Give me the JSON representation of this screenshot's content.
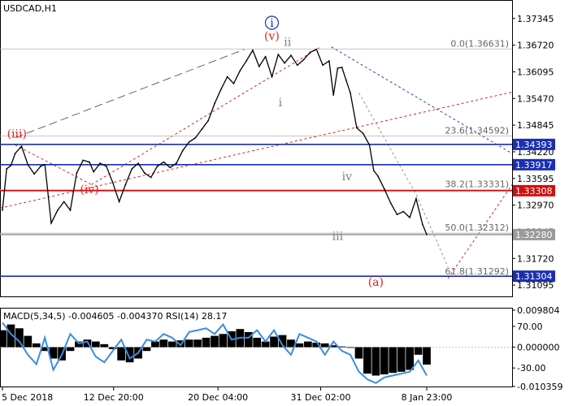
{
  "chart_data": [
    {
      "type": "line",
      "title": "USDCAD,H1",
      "ylim": [
        1.3085,
        1.3774
      ],
      "y_ticks": [
        "1.37345",
        "1.36720",
        "1.36095",
        "1.35470",
        "1.34845",
        "1.34220",
        "1.33595",
        "1.32970",
        "1.32345",
        "1.31720",
        "1.31095"
      ],
      "y_tick_values": [
        1.37345,
        1.3672,
        1.36095,
        1.3547,
        1.34845,
        1.3422,
        1.33595,
        1.3297,
        1.32345,
        1.3172,
        1.31095
      ],
      "x_ticks": [
        "5 Dec 2018",
        "12 Dec 20:00",
        "20 Dec 04:00",
        "31 Dec 02:00",
        "8 Jan 23:00"
      ],
      "x_tick_positions": [
        0.0,
        0.262,
        0.508,
        0.75,
        1.0
      ],
      "series": [
        {
          "x": [
            0.0,
            0.01,
            0.02,
            0.03,
            0.045,
            0.06,
            0.075,
            0.09,
            0.1,
            0.115,
            0.13,
            0.145,
            0.16,
            0.175,
            0.19,
            0.205,
            0.215,
            0.23,
            0.245,
            0.26,
            0.275,
            0.29,
            0.305,
            0.32,
            0.335,
            0.35,
            0.365,
            0.38,
            0.395,
            0.41,
            0.425,
            0.44,
            0.455,
            0.47,
            0.485,
            0.5,
            0.515,
            0.53,
            0.545,
            0.56,
            0.575,
            0.59,
            0.605,
            0.62,
            0.635,
            0.65,
            0.665,
            0.68,
            0.695,
            0.71,
            0.725,
            0.74,
            0.755,
            0.77,
            0.78,
            0.79,
            0.8,
            0.81,
            0.82,
            0.835,
            0.85,
            0.865,
            0.875,
            0.885,
            0.9,
            0.915,
            0.93,
            0.945,
            0.96,
            0.975,
            0.99,
            1.0
          ],
          "values": [
            1.3285,
            1.3382,
            1.339,
            1.3418,
            1.3435,
            1.3392,
            1.337,
            1.3388,
            1.3392,
            1.3255,
            1.3285,
            1.3305,
            1.3285,
            1.3372,
            1.3402,
            1.3398,
            1.3375,
            1.3395,
            1.3388,
            1.335,
            1.3305,
            1.3345,
            1.3382,
            1.3395,
            1.3372,
            1.3362,
            1.3388,
            1.3398,
            1.3385,
            1.3395,
            1.3425,
            1.3445,
            1.3455,
            1.3475,
            1.3495,
            1.3535,
            1.3568,
            1.3598,
            1.3582,
            1.3612,
            1.3635,
            1.366,
            1.3622,
            1.3645,
            1.3598,
            1.365,
            1.363,
            1.3648,
            1.3625,
            1.3638,
            1.3655,
            1.3662,
            1.3625,
            1.3635,
            1.3555,
            1.3618,
            1.362,
            1.359,
            1.356,
            1.3478,
            1.3465,
            1.3438,
            1.3378,
            1.3365,
            1.3335,
            1.3302,
            1.3275,
            1.3282,
            1.3268,
            1.3312,
            1.3252,
            1.3228
          ]
        }
      ],
      "horizontal_levels": [
        {
          "price": "1.34393",
          "value": 1.34393,
          "color": "#1b2fb0"
        },
        {
          "price": "1.33917",
          "value": 1.33917,
          "color": "#1b2fb0"
        },
        {
          "price": "1.33308",
          "value": 1.33308,
          "color": "#d01010"
        },
        {
          "price": "1.32280",
          "value": 1.3228,
          "color": "#9a9a9a"
        },
        {
          "price": "1.31304",
          "value": 1.31304,
          "color": "#1b2fb0"
        }
      ],
      "fibonacci": [
        {
          "label": "0.0(1.36631)",
          "value": 1.36631
        },
        {
          "label": "23.6(1.34592)",
          "value": 1.34592
        },
        {
          "label": "38.2(1.33331)",
          "value": 1.33331
        },
        {
          "label": "50.0(1.32312)",
          "value": 1.32312
        },
        {
          "label": "61.8(1.31292)",
          "value": 1.31292
        }
      ],
      "wave_labels": [
        {
          "text": "(iii)",
          "color": "#e0201b",
          "x": 0.034,
          "y": 1.3455
        },
        {
          "text": "(iv)",
          "color": "#e0201b",
          "x": 0.205,
          "y": 1.3325
        },
        {
          "text": "(v)",
          "color": "#e0201b",
          "x": 0.635,
          "y": 1.3685
        },
        {
          "text": "i",
          "color": "#1b2fb0",
          "x": 0.635,
          "y": 1.3715,
          "circled": true
        },
        {
          "text": "ii",
          "color": "#7f7f7f",
          "x": 0.672,
          "y": 1.367
        },
        {
          "text": "i",
          "color": "#7f7f7f",
          "x": 0.655,
          "y": 1.3528
        },
        {
          "text": "iii",
          "color": "#7f7f7f",
          "x": 0.79,
          "y": 1.3215
        },
        {
          "text": "iv",
          "color": "#7f7f7f",
          "x": 0.812,
          "y": 1.3355
        },
        {
          "text": "(a)",
          "color": "#e0201b",
          "x": 0.88,
          "y": 1.3108
        }
      ]
    },
    {
      "type": "line",
      "title": "MACD(5,34,5) -0.004605 -0.004370 RSI(14) 28.17",
      "ylim": [
        -0.0104,
        0.01
      ],
      "y_ticks": [
        "0.009804",
        "70.00",
        "0.000000",
        "-30.00",
        "-0.010359"
      ],
      "y_tick_values": [
        0.009804,
        0.0055,
        0.0,
        -0.0055,
        -0.010359
      ],
      "series": [
        {
          "name": "MACD histogram",
          "x": [
            0.0,
            0.02,
            0.04,
            0.06,
            0.08,
            0.1,
            0.12,
            0.14,
            0.16,
            0.18,
            0.2,
            0.22,
            0.24,
            0.26,
            0.28,
            0.3,
            0.32,
            0.34,
            0.36,
            0.38,
            0.4,
            0.42,
            0.44,
            0.46,
            0.48,
            0.5,
            0.52,
            0.54,
            0.56,
            0.58,
            0.6,
            0.62,
            0.64,
            0.66,
            0.68,
            0.7,
            0.72,
            0.74,
            0.76,
            0.78,
            0.8,
            0.82,
            0.84,
            0.86,
            0.88,
            0.9,
            0.92,
            0.94,
            0.96,
            0.98,
            1.0
          ],
          "values": [
            0.0045,
            0.006,
            0.005,
            0.003,
            0.001,
            -0.001,
            -0.003,
            -0.0035,
            -0.001,
            0.0015,
            0.002,
            0.0015,
            0.0008,
            -0.0005,
            -0.0035,
            -0.004,
            -0.003,
            -0.001,
            0.0015,
            0.002,
            0.0015,
            0.0018,
            0.002,
            0.002,
            0.0025,
            0.003,
            0.0035,
            0.0042,
            0.0048,
            0.004,
            0.0025,
            0.0015,
            0.0028,
            0.0032,
            0.002,
            0.001,
            0.0015,
            0.0012,
            0.001,
            0.0005,
            0.0002,
            0.0,
            -0.003,
            -0.007,
            -0.0075,
            -0.0072,
            -0.0068,
            -0.0065,
            -0.006,
            -0.002,
            -0.0046
          ]
        },
        {
          "name": "RSI(14)",
          "x": [
            0.0,
            0.02,
            0.04,
            0.06,
            0.08,
            0.1,
            0.12,
            0.14,
            0.16,
            0.18,
            0.2,
            0.22,
            0.24,
            0.26,
            0.28,
            0.3,
            0.32,
            0.34,
            0.36,
            0.38,
            0.4,
            0.42,
            0.44,
            0.46,
            0.48,
            0.5,
            0.52,
            0.54,
            0.56,
            0.58,
            0.6,
            0.62,
            0.64,
            0.66,
            0.68,
            0.7,
            0.72,
            0.74,
            0.76,
            0.78,
            0.8,
            0.82,
            0.84,
            0.86,
            0.88,
            0.9,
            0.92,
            0.94,
            0.96,
            0.98,
            1.0
          ],
          "values": [
            0.0065,
            0.0035,
            0.0015,
            -0.002,
            -0.0045,
            0.0025,
            -0.006,
            -0.002,
            0.0035,
            0.001,
            0.0015,
            -0.0025,
            -0.004,
            -0.001,
            0.002,
            -0.003,
            -0.0015,
            0.002,
            0.0015,
            0.0035,
            0.0025,
            0.0005,
            0.004,
            0.0045,
            0.005,
            0.0035,
            0.006,
            0.002,
            0.0025,
            0.0025,
            0.0045,
            0.0015,
            0.0045,
            0.0005,
            -0.002,
            0.0035,
            0.0025,
            0.0015,
            -0.002,
            0.0015,
            -0.001,
            -0.002,
            -0.0065,
            -0.0085,
            -0.0095,
            -0.008,
            -0.0075,
            -0.007,
            -0.0065,
            -0.0035,
            -0.0075
          ]
        }
      ]
    }
  ],
  "colors": {
    "price_line": "#000000",
    "level_blue": "#1b2fb0",
    "level_red": "#d01010",
    "level_grey": "#9a9a9a",
    "rsi_line": "#3a8de0",
    "wave_red": "#e0201b",
    "wave_grey": "#7f7f7f",
    "wave_blue": "#1b2fb0"
  }
}
